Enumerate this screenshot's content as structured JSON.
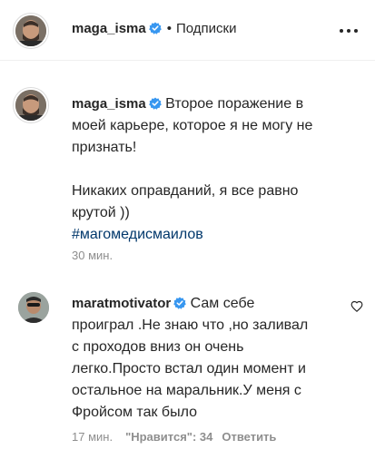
{
  "header": {
    "username": "maga_isma",
    "separator": "•",
    "follow_label": "Подписки",
    "more_icon": "more-horizontal-icon"
  },
  "post": {
    "username": "maga_isma",
    "lines": [
      "Второе поражение в",
      "моей карьере, которое я не могу не",
      "признать!",
      "",
      "Никаких оправданий, я все равно",
      "крутой ))"
    ],
    "hashtag": "#магомедисмаилов",
    "time": "30 мин."
  },
  "comment": {
    "username": "maratmotivator",
    "lines": [
      "Сам себе",
      "проиграл .Не знаю что ,но заливал",
      "с проходов вниз он очень",
      "легко.Просто встал один момент и",
      "остальное на маральник.У меня с",
      "Фройсом так было"
    ],
    "time": "17 мин.",
    "likes": "\"Нравится\": 34",
    "reply_label": "Ответить",
    "like_icon": "heart-outline-icon"
  },
  "colors": {
    "verified": "#3897f0",
    "hashtag": "#00376b",
    "muted": "#8e8e8e",
    "text": "#262626"
  }
}
